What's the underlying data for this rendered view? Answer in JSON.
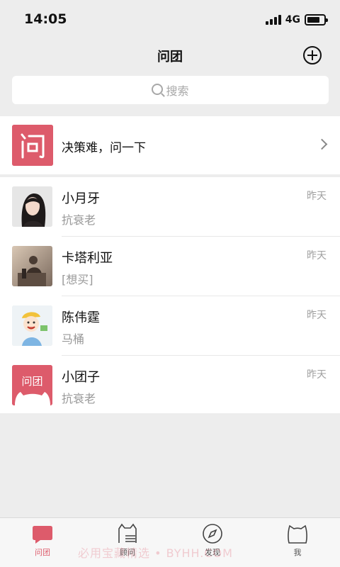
{
  "status_bar": {
    "time": "14:05",
    "network": "4G"
  },
  "nav": {
    "title": "问团",
    "add_icon": "plus-circle-icon"
  },
  "search": {
    "placeholder": "搜索",
    "icon": "search-icon"
  },
  "ask_entry": {
    "logo_text": "问",
    "label": "决策难，问一下",
    "chevron_icon": "chevron-right-icon"
  },
  "conversations": [
    {
      "name": "小月牙",
      "preview": "抗衰老",
      "time": "昨天",
      "avatar": "woman-portrait-photo"
    },
    {
      "name": "卡塔利亚",
      "preview": "[想买]",
      "time": "昨天",
      "avatar": "person-photo"
    },
    {
      "name": "陈伟霆",
      "preview": "马桶",
      "time": "昨天",
      "avatar": "cartoon-boy"
    },
    {
      "name": "小团子",
      "preview": "抗衰老",
      "time": "昨天",
      "avatar": "wentuan-logo",
      "avatar_text": "问团"
    }
  ],
  "tabs": [
    {
      "label": "问团",
      "active": true,
      "icon": "chat-bubble-icon"
    },
    {
      "label": "顾问",
      "active": false,
      "icon": "cat-list-icon"
    },
    {
      "label": "发现",
      "active": false,
      "icon": "compass-icon"
    },
    {
      "label": "我",
      "active": false,
      "icon": "cat-head-icon"
    }
  ],
  "watermark": "必用宝藏精选 • BYHH.COM",
  "colors": {
    "accent": "#dd5b6b",
    "background": "#ededed",
    "secondary_text": "#999999"
  }
}
